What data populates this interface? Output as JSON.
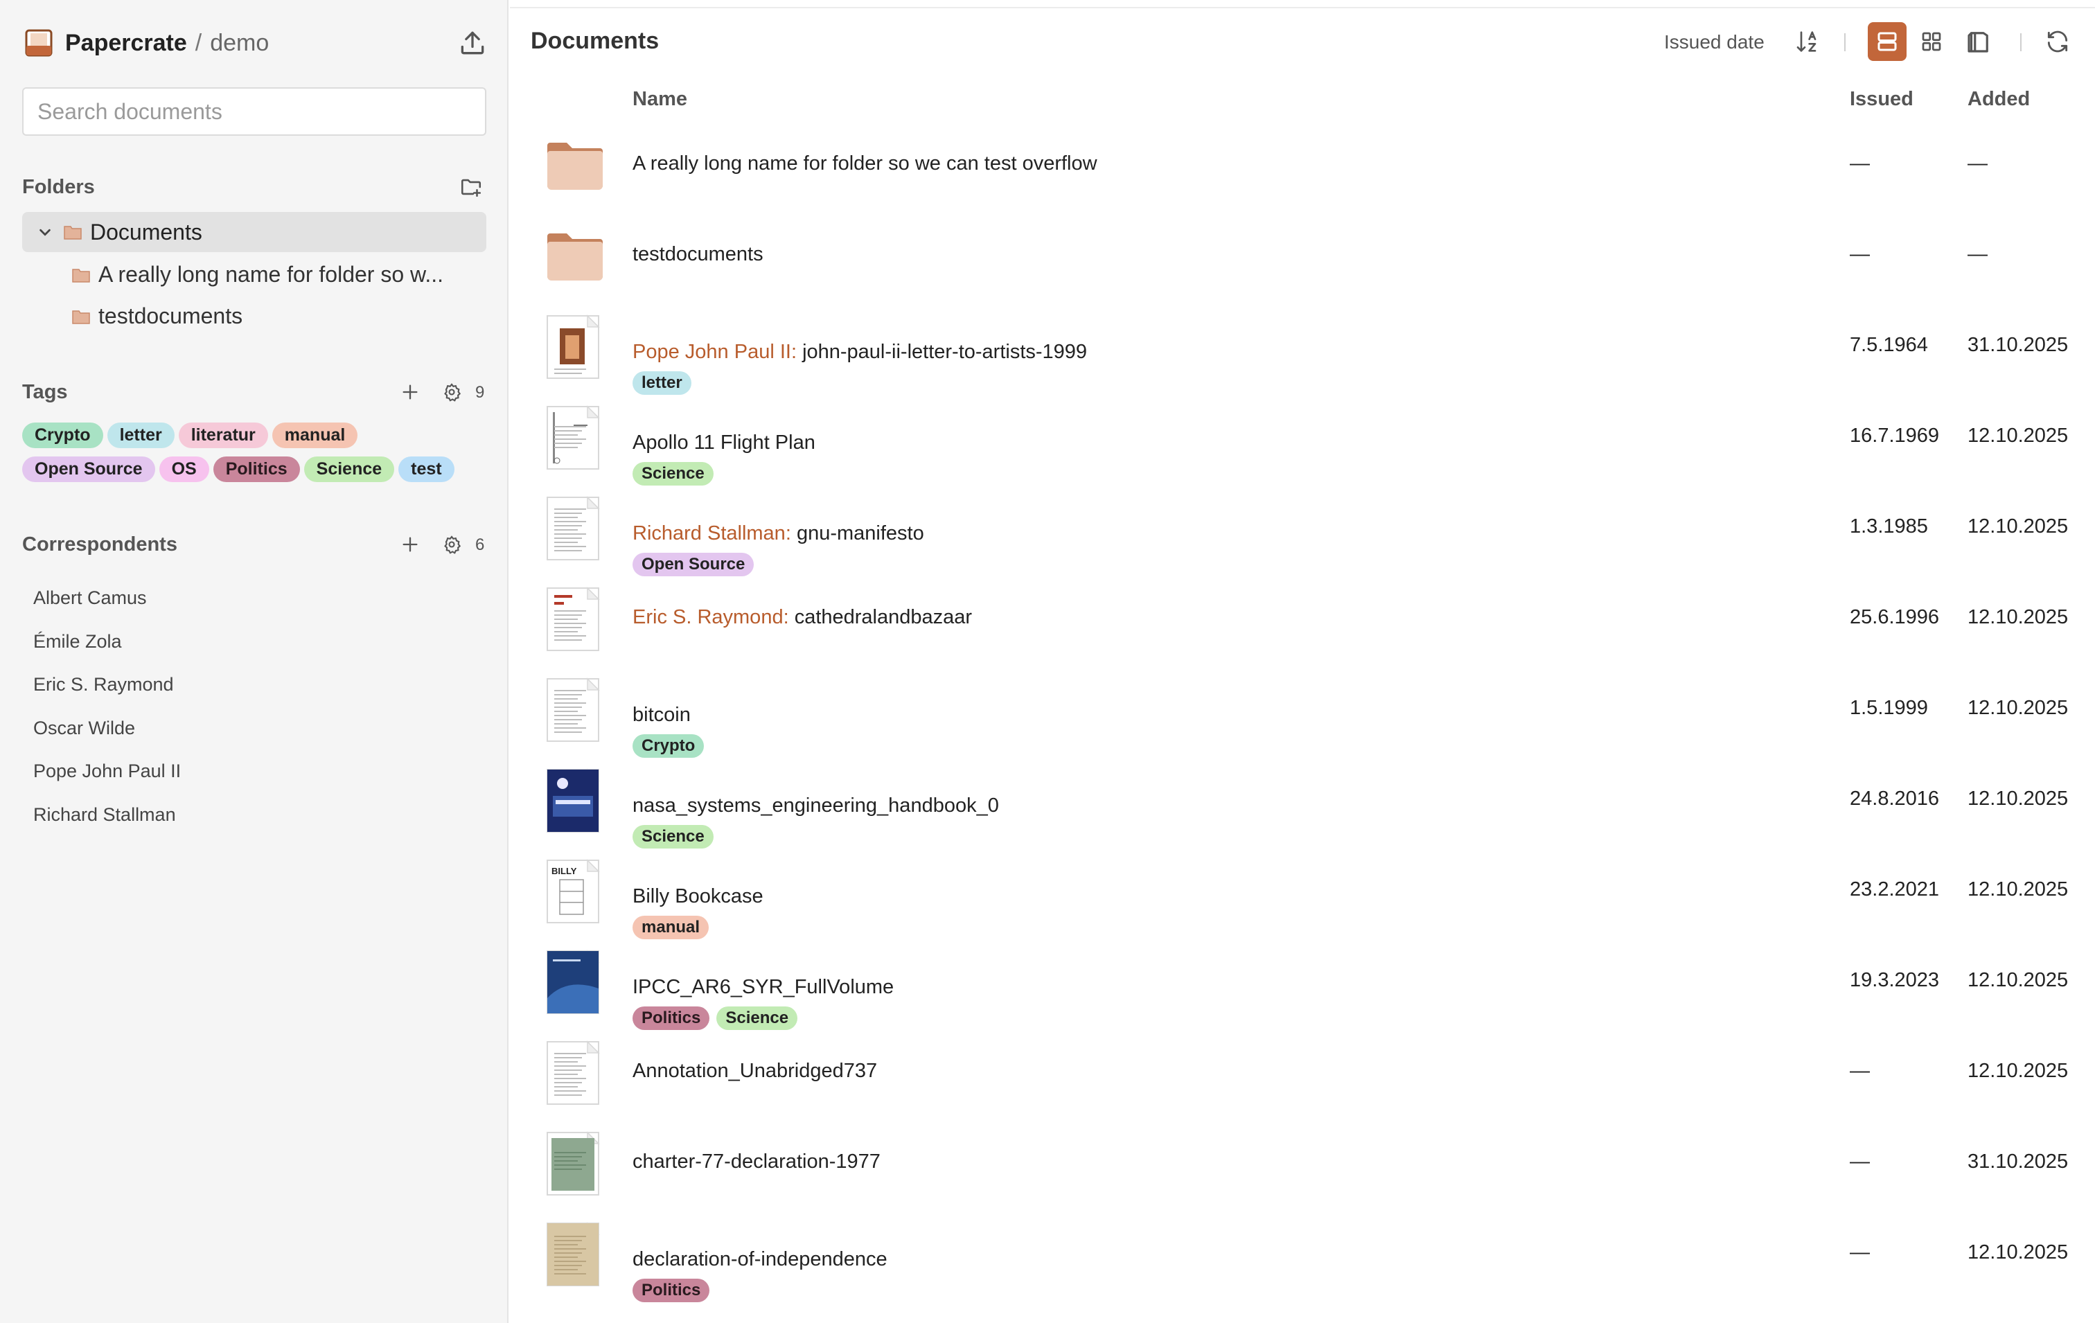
{
  "app": {
    "name": "Papercrate",
    "separator": "/",
    "workspace": "demo"
  },
  "search": {
    "placeholder": "Search documents",
    "value": ""
  },
  "sidebar": {
    "folders_title": "Folders",
    "folders": {
      "root": "Documents",
      "children": [
        "A really long name for folder so w...",
        "testdocuments"
      ]
    },
    "tags_title": "Tags",
    "tags_count": "9",
    "tags": [
      {
        "label": "Crypto",
        "color": "#a8e2c4"
      },
      {
        "label": "letter",
        "color": "#bfe6ec"
      },
      {
        "label": "literatur",
        "color": "#f6c9d8"
      },
      {
        "label": "manual",
        "color": "#f5c4b2"
      },
      {
        "label": "Open Source",
        "color": "#e3c6ef"
      },
      {
        "label": "OS",
        "color": "#f7c2ee"
      },
      {
        "label": "Politics",
        "color": "#c9869b"
      },
      {
        "label": "Science",
        "color": "#c2ebb4"
      },
      {
        "label": "test",
        "color": "#b9def8"
      }
    ],
    "correspondents_title": "Correspondents",
    "correspondents_count": "6",
    "correspondents": [
      "Albert Camus",
      "Émile Zola",
      "Eric S. Raymond",
      "Oscar Wilde",
      "Pope John Paul II",
      "Richard Stallman"
    ]
  },
  "main": {
    "title": "Documents",
    "sort_label": "Issued date",
    "columns": {
      "name": "Name",
      "issued": "Issued",
      "added": "Added"
    },
    "rows": [
      {
        "type": "folder",
        "name": "A really long name for folder so we can test overflow",
        "issued": "—",
        "added": "—"
      },
      {
        "type": "folder",
        "name": "testdocuments",
        "issued": "—",
        "added": "—"
      },
      {
        "type": "doc",
        "correspondent": "Pope John Paul II:",
        "name": "john-paul-ii-letter-to-artists-1999",
        "tags": [
          "letter"
        ],
        "issued": "7.5.1964",
        "added": "31.10.2025",
        "thumb": "portrait"
      },
      {
        "type": "doc",
        "correspondent": "",
        "name": "Apollo 11 Flight Plan",
        "tags": [
          "Science"
        ],
        "issued": "16.7.1969",
        "added": "12.10.2025",
        "thumb": "form"
      },
      {
        "type": "doc",
        "correspondent": "Richard Stallman:",
        "name": "gnu-manifesto",
        "tags": [
          "Open Source"
        ],
        "issued": "1.3.1985",
        "added": "12.10.2025",
        "thumb": "text"
      },
      {
        "type": "doc",
        "correspondent": "Eric S. Raymond:",
        "name": "cathedralandbazaar",
        "tags": [],
        "issued": "25.6.1996",
        "added": "12.10.2025",
        "thumb": "redtext"
      },
      {
        "type": "doc",
        "correspondent": "",
        "name": "bitcoin",
        "tags": [
          "Crypto"
        ],
        "issued": "1.5.1999",
        "added": "12.10.2025",
        "thumb": "text"
      },
      {
        "type": "doc",
        "correspondent": "",
        "name": "nasa_systems_engineering_handbook_0",
        "tags": [
          "Science"
        ],
        "issued": "24.8.2016",
        "added": "12.10.2025",
        "thumb": "nasa"
      },
      {
        "type": "doc",
        "correspondent": "",
        "name": "Billy Bookcase",
        "tags": [
          "manual"
        ],
        "issued": "23.2.2021",
        "added": "12.10.2025",
        "thumb": "billy"
      },
      {
        "type": "doc",
        "correspondent": "",
        "name": "IPCC_AR6_SYR_FullVolume",
        "tags": [
          "Politics",
          "Science"
        ],
        "issued": "19.3.2023",
        "added": "12.10.2025",
        "thumb": "ipcc"
      },
      {
        "type": "doc",
        "correspondent": "",
        "name": "Annotation_Unabridged737",
        "tags": [],
        "issued": "—",
        "added": "12.10.2025",
        "thumb": "text"
      },
      {
        "type": "doc",
        "correspondent": "",
        "name": "charter-77-declaration-1977",
        "tags": [],
        "issued": "—",
        "added": "31.10.2025",
        "thumb": "green"
      },
      {
        "type": "doc",
        "correspondent": "",
        "name": "declaration-of-independence",
        "tags": [
          "Politics"
        ],
        "issued": "—",
        "added": "12.10.2025",
        "thumb": "parchment"
      }
    ]
  },
  "billy_thumb_text": "BILLY"
}
